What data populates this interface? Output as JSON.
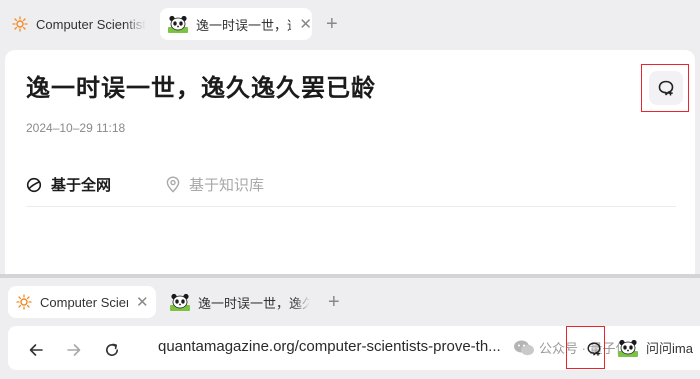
{
  "top_window": {
    "tabs": [
      {
        "title": "Computer Scientists",
        "icon": "sun-icon"
      },
      {
        "title": "逸一时误一世，逸久逸久罢已龄",
        "icon": "panda-icon",
        "active": true
      }
    ],
    "article": {
      "title": "逸一时误一世，逸久逸久罢已龄",
      "date": "2024–10–29 11:18",
      "options": [
        {
          "label": "基于全网",
          "icon": "globe-icon",
          "selected": true
        },
        {
          "label": "基于知识库",
          "icon": "location-pin-icon",
          "selected": false
        }
      ]
    },
    "extension_button_icon": "ai-assistant-icon"
  },
  "bottom_window": {
    "tabs": [
      {
        "title": "Computer Scientists",
        "icon": "sun-icon",
        "active": true
      },
      {
        "title": "逸一时误一世，逸久逸久罢已龄",
        "icon": "panda-icon"
      }
    ],
    "address_bar": {
      "url": "quantamagazine.org/computer-scientists-prove-th..."
    },
    "watermark": "公众号 · 量子位",
    "extension_label": "问问ima"
  },
  "colors": {
    "highlight_border": "#e8262d",
    "tab_bar_bg": "#eeeef0",
    "accent_sun": "#f08a24"
  }
}
